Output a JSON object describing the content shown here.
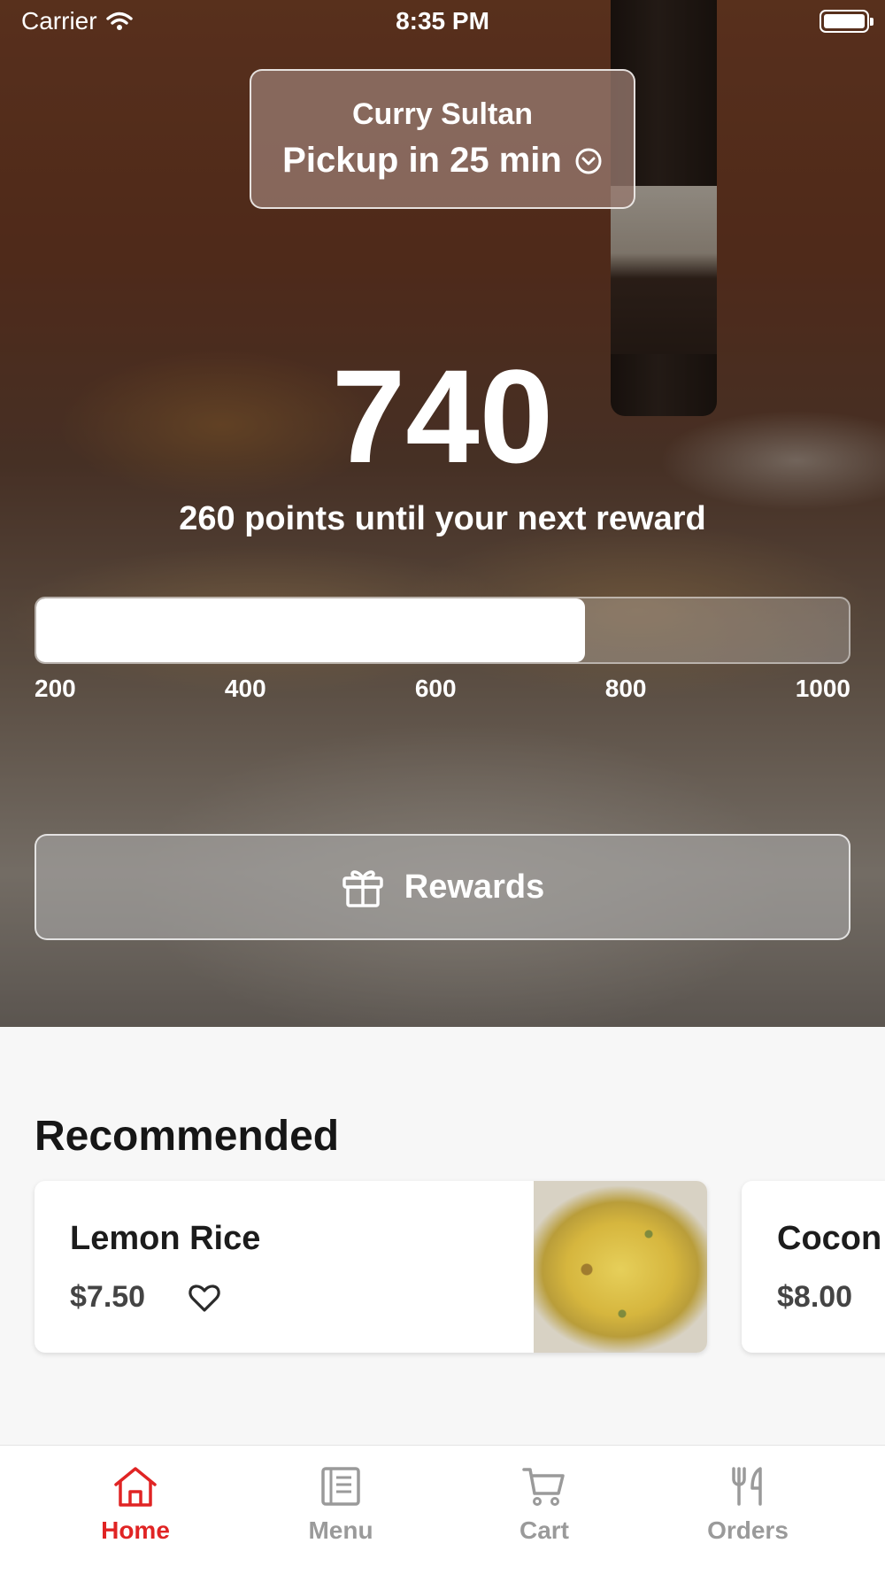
{
  "status_bar": {
    "carrier": "Carrier",
    "time": "8:35 PM"
  },
  "location": {
    "restaurant_name": "Curry Sultan",
    "pickup_text": "Pickup in 25 min"
  },
  "rewards_progress": {
    "points": "740",
    "subtitle": "260 points until your next reward",
    "progress_value": 740,
    "scale_min": 200,
    "scale_max": 1000,
    "ticks": [
      "200",
      "400",
      "600",
      "800",
      "1000"
    ]
  },
  "rewards_button": {
    "label": "Rewards",
    "icon": "gift-icon"
  },
  "recommended": {
    "title": "Recommended",
    "items": [
      {
        "name": "Lemon Rice",
        "price": "$7.50",
        "favorite_icon": "heart-icon"
      },
      {
        "name": "Cocon",
        "price": "$8.00"
      }
    ]
  },
  "tab_bar": {
    "tabs": [
      {
        "label": "Home",
        "icon": "home-icon",
        "active": true
      },
      {
        "label": "Menu",
        "icon": "menu-icon",
        "active": false
      },
      {
        "label": "Cart",
        "icon": "cart-icon",
        "active": false
      },
      {
        "label": "Orders",
        "icon": "utensils-icon",
        "active": false
      }
    ]
  },
  "colors": {
    "accent": "#e02424",
    "inactive_tab": "#9a9a9a",
    "background": "#f7f7f7"
  }
}
